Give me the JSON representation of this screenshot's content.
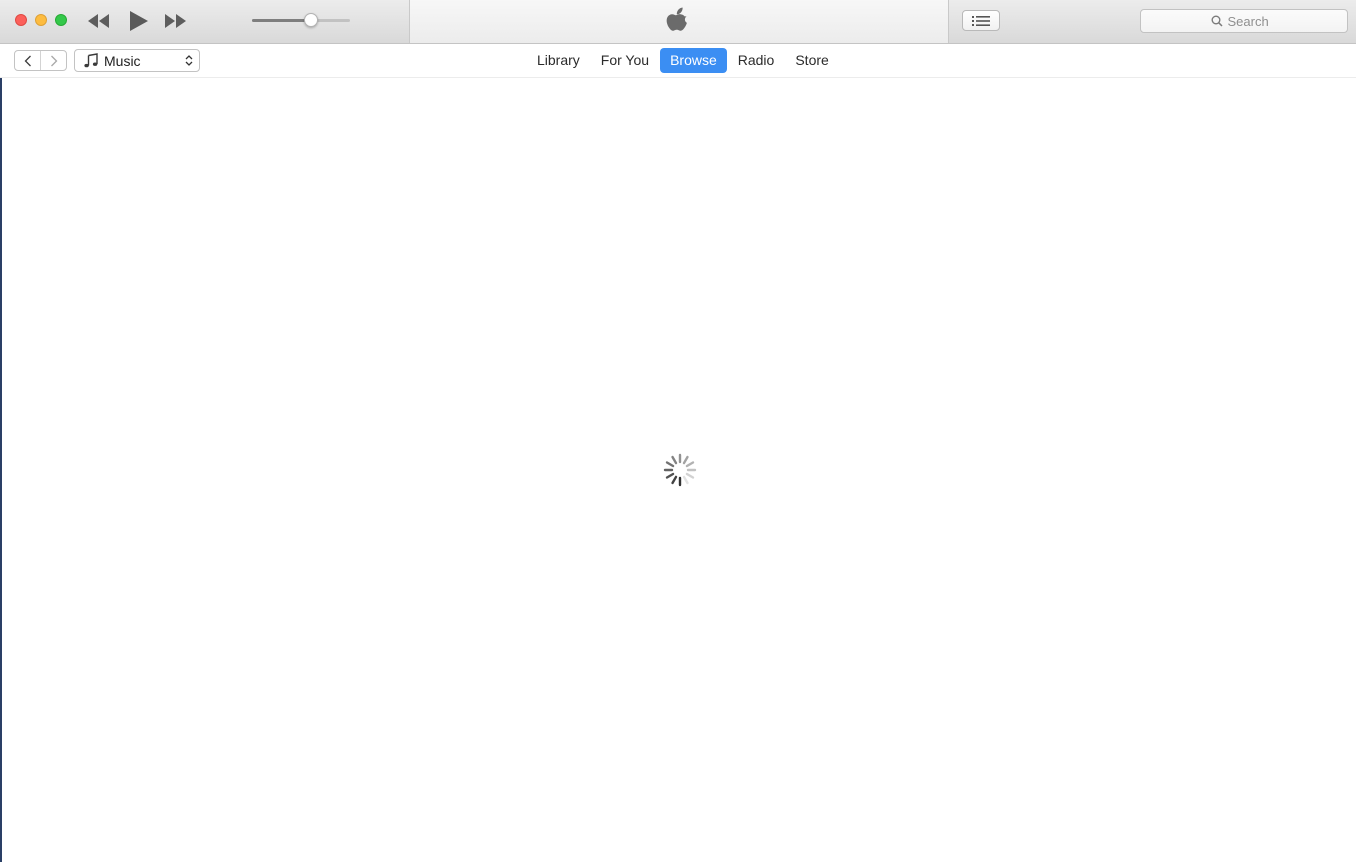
{
  "window": {
    "controls": [
      "close",
      "minimize",
      "maximize"
    ],
    "colors": {
      "close": "#fc605b",
      "minimize": "#fdbc40",
      "maximize": "#34c84a"
    }
  },
  "player": {
    "icons": [
      "rewind-icon",
      "play-icon",
      "fast-forward-icon"
    ],
    "volume_fraction": 0.6
  },
  "lcd": {
    "icon": "apple-logo-icon"
  },
  "toolbar": {
    "list_icon": "list-icon"
  },
  "search": {
    "placeholder": "Search",
    "icon": "search-icon"
  },
  "nav": {
    "back_icon": "chevron-left-icon",
    "forward_icon": "chevron-right-icon"
  },
  "media_kind": {
    "label": "Music",
    "icon": "music-note-icon"
  },
  "tabs": [
    {
      "label": "Library",
      "selected": false
    },
    {
      "label": "For You",
      "selected": false
    },
    {
      "label": "Browse",
      "selected": true
    },
    {
      "label": "Radio",
      "selected": false
    },
    {
      "label": "Store",
      "selected": false
    }
  ],
  "accent_color": "#3b8ef3",
  "content": {
    "state": "loading",
    "icon": "loading-spinner-icon"
  }
}
